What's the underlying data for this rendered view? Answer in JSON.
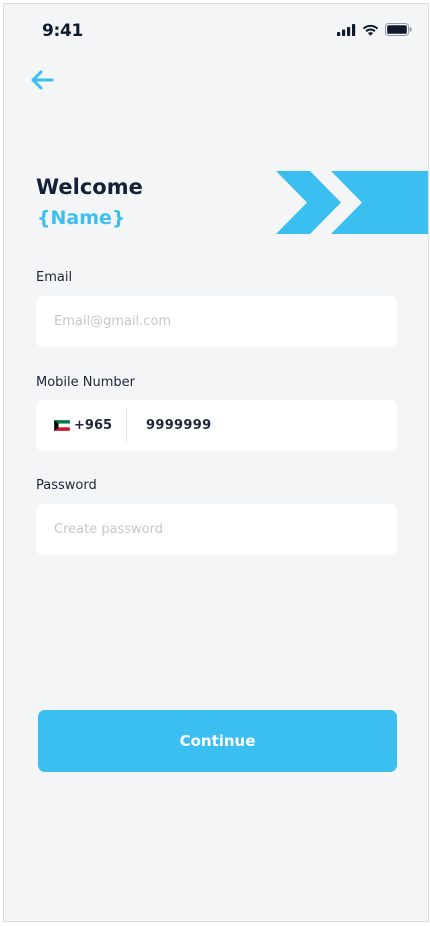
{
  "status_bar": {
    "time": "9:41",
    "icons": [
      "signal-icon",
      "wifi-icon",
      "battery-icon"
    ]
  },
  "header": {
    "back_icon": "arrow-left-icon",
    "welcome": "Welcome",
    "name": "{Name}"
  },
  "form": {
    "email": {
      "label": "Email",
      "placeholder": "Email@gmail.com",
      "value": ""
    },
    "mobile": {
      "label": "Mobile Number",
      "country_flag": "kuwait-flag-icon",
      "country_code": "+965",
      "value": "9999999"
    },
    "password": {
      "label": "Password",
      "placeholder": "Create password",
      "value": ""
    }
  },
  "actions": {
    "continue_label": "Continue"
  },
  "colors": {
    "accent": "#3bbff0",
    "title": "#142238",
    "background": "#f3f5f7",
    "field": "#ffffff"
  }
}
